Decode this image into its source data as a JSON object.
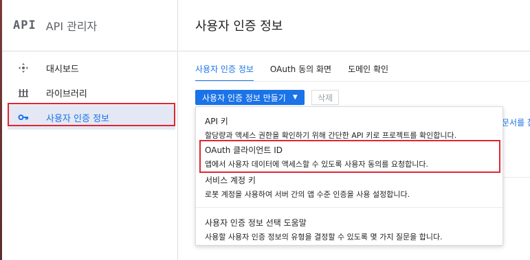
{
  "sidebar": {
    "logo": "API",
    "title": "API 관리자",
    "items": [
      {
        "label": "대시보드",
        "icon": "dashboard-icon"
      },
      {
        "label": "라이브러리",
        "icon": "library-icon"
      },
      {
        "label": "사용자 인증 정보",
        "icon": "key-icon",
        "active": true
      }
    ]
  },
  "main": {
    "title": "사용자 인증 정보",
    "tabs": [
      {
        "label": "사용자 인증 정보",
        "active": true
      },
      {
        "label": "OAuth 동의 화면"
      },
      {
        "label": "도메인 확인"
      }
    ],
    "create_label": "사용자 인증 정보 만들기",
    "delete_label": "삭제",
    "right_clip_text": "문서를 참"
  },
  "dropdown": {
    "items": [
      {
        "title": "API 키",
        "desc": "할당량과 액세스 권한을 확인하기 위해 간단한 API 키로 프로젝트를 확인합니다."
      },
      {
        "title": "OAuth 클라이언트 ID",
        "desc": "앱에서 사용자 데이터에 액세스할 수 있도록 사용자 동의를 요청합니다."
      },
      {
        "title": "서비스 계정 키",
        "desc": "로봇 계정을 사용하여 서버 간의 앱 수준 인증을 사용 설정합니다."
      },
      {
        "title": "사용자 인증 정보 선택 도움말",
        "desc": "사용할 사용자 인증 정보의 유형을 결정할 수 있도록 몇 가지 질문을 합니다."
      }
    ]
  },
  "colors": {
    "accent": "#1a73e8",
    "highlight": "#e0242f",
    "active_bg": "#e3e8f4"
  }
}
